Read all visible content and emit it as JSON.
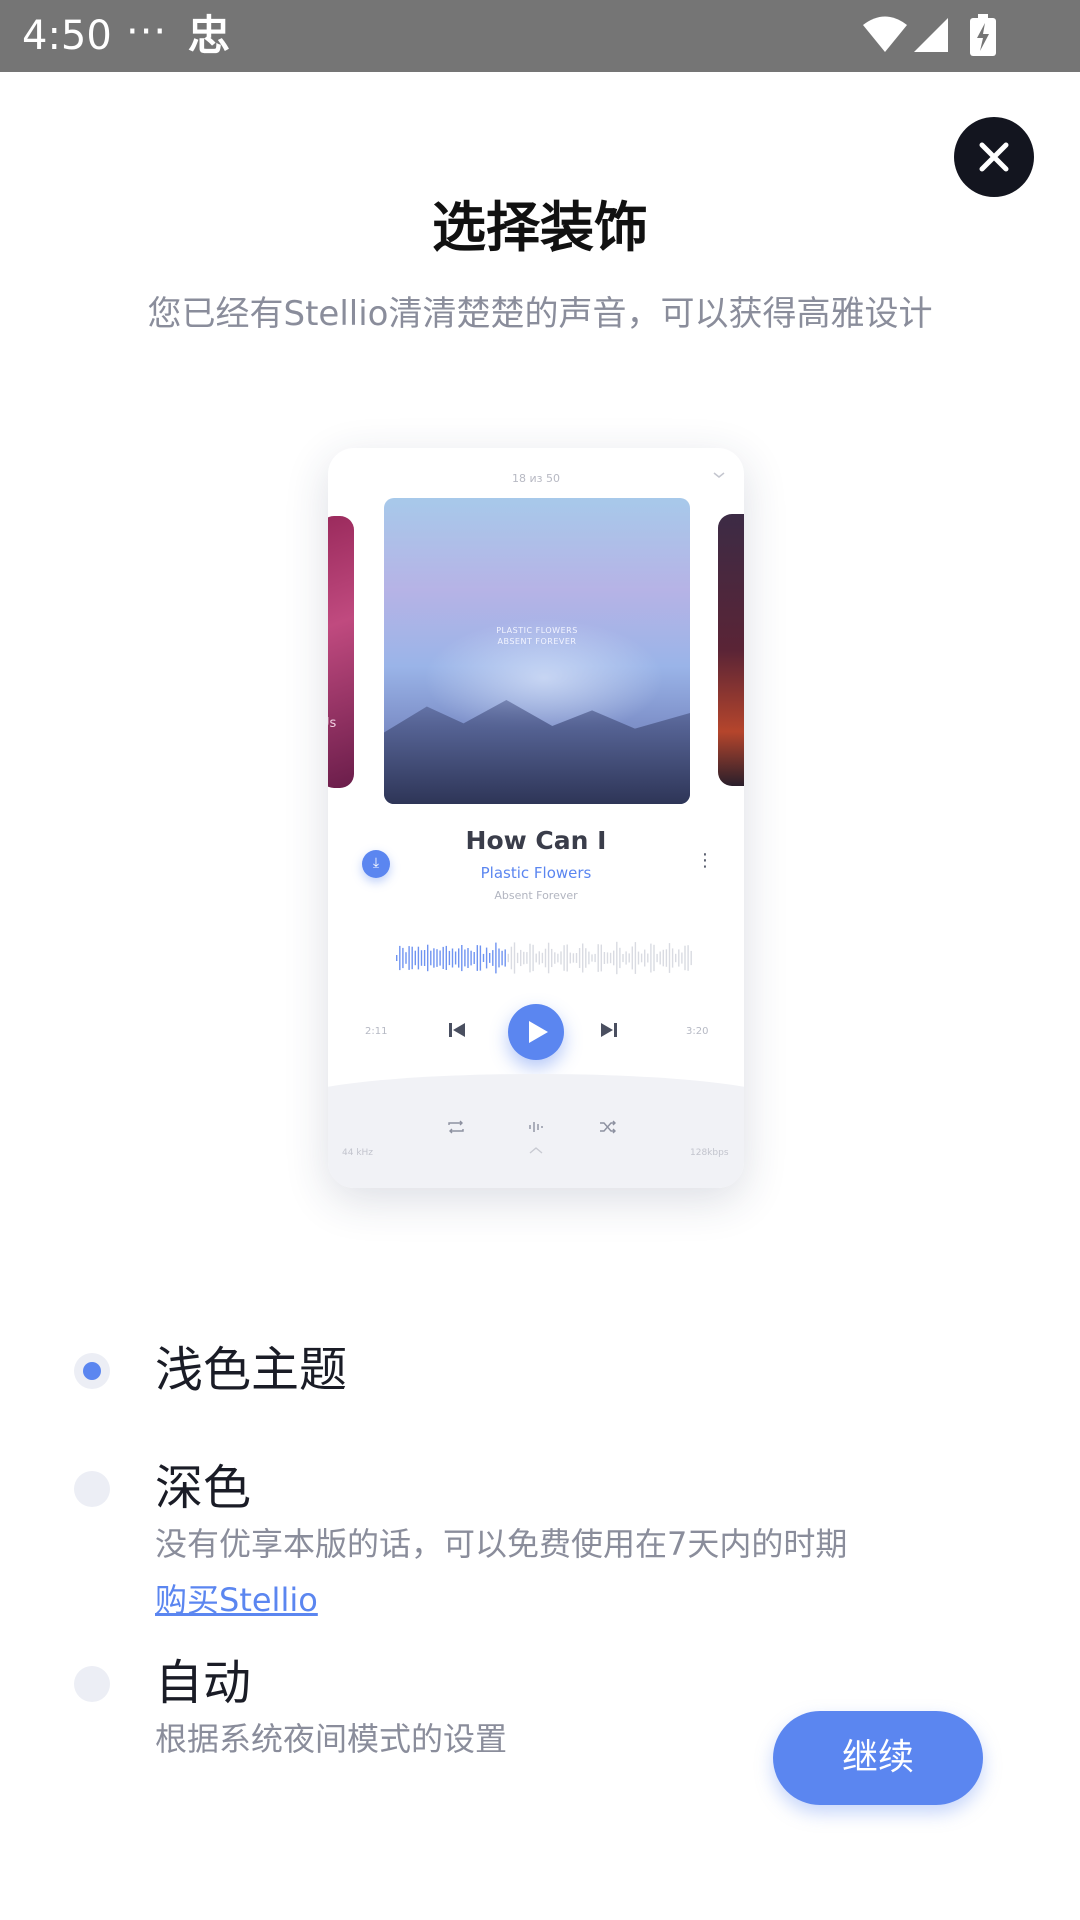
{
  "status_bar": {
    "time": "4:50",
    "dots": "···",
    "app_glyph": "忠"
  },
  "header": {
    "title": "选择装饰",
    "subtitle": "您已经有Stellio清清楚楚的声音，可以获得高雅设计"
  },
  "preview": {
    "track_counter": "18 из 50",
    "left_card_text": "Us",
    "album_text_1": "PLASTIC FLOWERS",
    "album_text_2": "ABSENT  FOREVER",
    "song_title": "How Can I",
    "artist": "Plastic Flowers",
    "album": "Absent Forever",
    "time_elapsed": "2:11",
    "time_total": "3:20",
    "sample_rate": "44 kHz",
    "bitrate": "128kbps"
  },
  "options": [
    {
      "title": "浅色主题",
      "selected": true
    },
    {
      "title": "深色",
      "description": "没有优享本版的话，可以免费使用在7天内的时期",
      "link": "购买Stellio",
      "selected": false
    },
    {
      "title": "自动",
      "description": "根据系统夜间模式的设置",
      "selected": false
    }
  ],
  "continue_label": "继续",
  "colors": {
    "accent": "#5b86f0",
    "status_bar": "#757575",
    "close_button": "#13151f",
    "radio_unselected": "#eceef5",
    "text_secondary": "#8a8d9b"
  },
  "icons": {
    "close": "close-icon",
    "download": "download-icon",
    "more": "more-vertical-icon",
    "previous": "skip-previous-icon",
    "play": "play-icon",
    "next": "skip-next-icon",
    "repeat": "repeat-icon",
    "equalizer": "equalizer-icon",
    "shuffle": "shuffle-icon"
  }
}
